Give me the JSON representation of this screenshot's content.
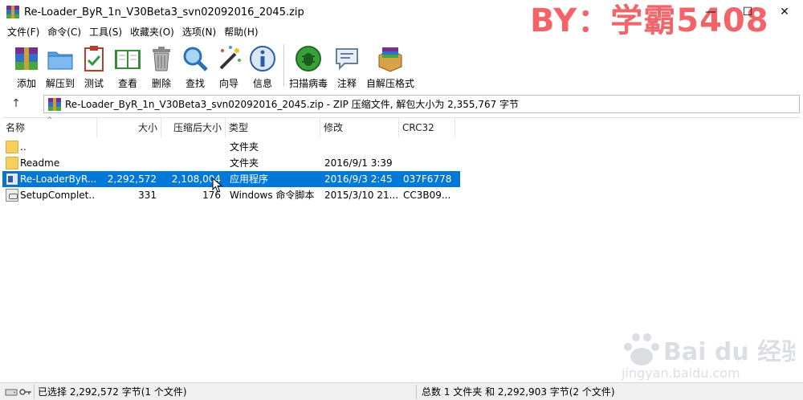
{
  "window": {
    "title": "Re-Loader_ByR_1n_V30Beta3_svn02092016_2045.zip",
    "watermark": "BY：学霸5408",
    "controls": {
      "minimize": "—",
      "maximize": "☐",
      "close": "✕"
    }
  },
  "menu": [
    "文件(F)",
    "命令(C)",
    "工具(S)",
    "收藏夹(O)",
    "选项(N)",
    "帮助(H)"
  ],
  "toolbar": {
    "add": "添加",
    "extract": "解压到",
    "test": "测试",
    "view": "查看",
    "delete": "删除",
    "find": "查找",
    "wizard": "向导",
    "info": "信息",
    "scan": "扫描病毒",
    "comment": "注释",
    "sfx": "自解压格式"
  },
  "address": {
    "up": "↑",
    "path": "Re-Loader_ByR_1n_V30Beta3_svn02092016_2045.zip - ZIP 压缩文件, 解包大小为 2,355,767 字节"
  },
  "columns": [
    "名称",
    "大小",
    "压缩后大小",
    "类型",
    "修改",
    "CRC32"
  ],
  "rows": [
    {
      "name": "..",
      "size": "",
      "packed": "",
      "type": "文件夹",
      "modified": "",
      "crc": "",
      "icon": "folder-icon",
      "selected": false
    },
    {
      "name": "Readme",
      "size": "",
      "packed": "",
      "type": "文件夹",
      "modified": "2016/9/1 3:39",
      "crc": "",
      "icon": "folder-icon",
      "selected": false
    },
    {
      "name": "Re-LoaderByR...",
      "size": "2,292,572",
      "packed": "2,108,004",
      "type": "应用程序",
      "modified": "2016/9/3 2:45",
      "crc": "037F6778",
      "icon": "exe-icon",
      "selected": true
    },
    {
      "name": "SetupComplet...",
      "size": "331",
      "packed": "176",
      "type": "Windows 命令脚本",
      "modified": "2015/3/10 21...",
      "crc": "CC3B09...",
      "icon": "script-icon",
      "selected": false
    }
  ],
  "status": {
    "left": "已选择 2,292,572 字节(1 个文件)",
    "right": "总数 1 文件夹 和 2,292,903 字节(2 个文件)"
  },
  "baidu_watermark": {
    "brand": "Bai du 经验",
    "url": "jingyan.baidu.com"
  },
  "colors": {
    "selection": "#0078d7",
    "watermark": "#f2646a"
  }
}
